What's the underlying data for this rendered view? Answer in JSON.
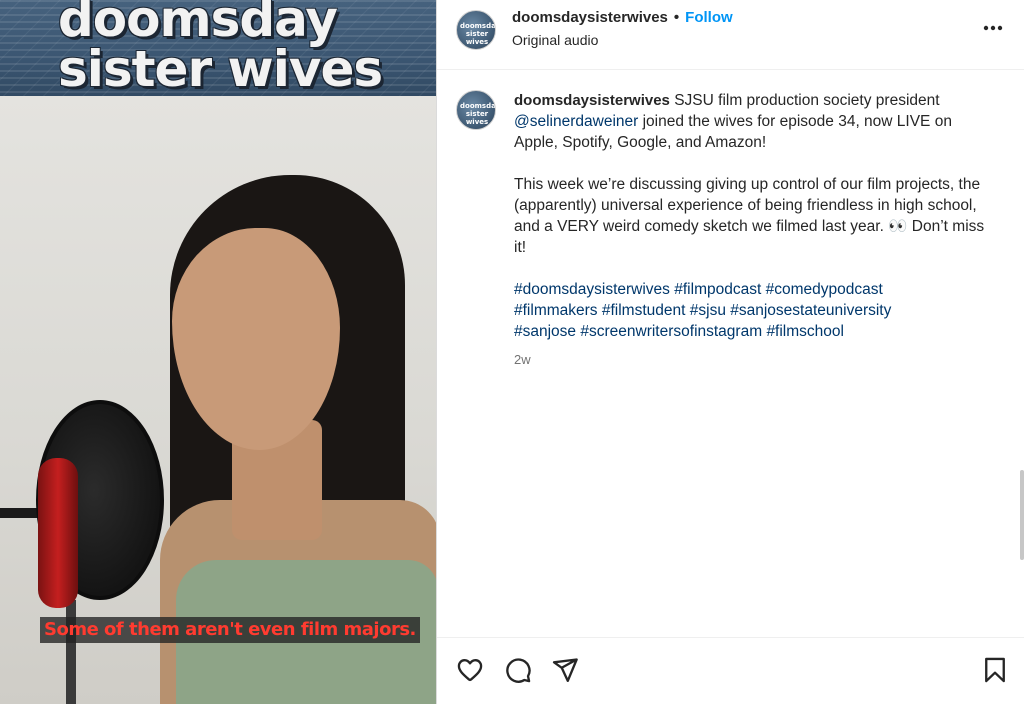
{
  "media": {
    "show_title_line1": "doomsday",
    "show_title_line2": "sister wives",
    "subtitle": "Some of them aren't even film majors."
  },
  "header": {
    "avatar_text": "doomsday sister wives",
    "username": "doomsdaysisterwives",
    "separator": "•",
    "follow_label": "Follow",
    "audio_label": "Original audio",
    "more_icon": "more-horizontal-icon"
  },
  "caption": {
    "username": "doomsdaysisterwives",
    "line1_text": "SJSU film production society president",
    "mention": "@selinerdaweiner",
    "line2_text": "joined the wives for episode 34, now LIVE on Apple, Spotify, Google, and Amazon!",
    "paragraph2": "This week we’re discussing giving up control of our film projects, the (apparently) universal experience of being friendless in high school, and a VERY weird comedy sketch we filmed last year. 👀 Don’t miss it!",
    "hashtags": [
      "#doomsdaysisterwives",
      "#filmpodcast",
      "#comedypodcast",
      "#filmmakers",
      "#filmstudent",
      "#sjsu",
      "#sanjosestateuniversity",
      "#sanjose",
      "#screenwritersofinstagram",
      "#filmschool"
    ],
    "timestamp": "2w"
  },
  "actions": {
    "like_icon": "heart-icon",
    "comment_icon": "comment-icon",
    "share_icon": "share-icon",
    "save_icon": "bookmark-icon"
  },
  "colors": {
    "link_blue": "#0095f6",
    "hashtag_blue": "#00376b",
    "subtitle_red": "#ff3b30",
    "text": "#262626",
    "muted": "#737373"
  }
}
